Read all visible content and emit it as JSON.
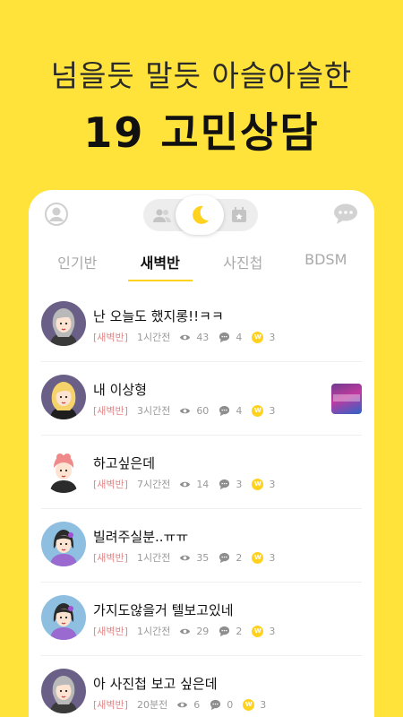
{
  "promo": {
    "headline": "넘을듯 말듯 아슬아슬한",
    "title": "19 고민상담"
  },
  "header": {
    "profile_icon": "person-icon",
    "toggle_left_icon": "people-icon",
    "toggle_mid_icon": "moon-icon",
    "toggle_right_icon": "calendar-star-icon",
    "chat_icon": "chat-bubble-icon"
  },
  "tabs": [
    {
      "label": "인기반",
      "active": false
    },
    {
      "label": "새벽반",
      "active": true
    },
    {
      "label": "사진첩",
      "active": false
    },
    {
      "label": "BDSM",
      "active": false
    }
  ],
  "posts": [
    {
      "title": "난 오늘도 했지롱!!ㅋㅋ",
      "tag": "[새벽반]",
      "time": "1시간전",
      "views": "43",
      "comments": "4",
      "coins": "3",
      "avatar": "gray-hair-woman"
    },
    {
      "title": "내 이상형",
      "tag": "[새벽반]",
      "time": "3시간전",
      "views": "60",
      "comments": "4",
      "coins": "3",
      "avatar": "blonde-woman",
      "has_thumb": true
    },
    {
      "title": "하고싶은데",
      "tag": "[새벽반]",
      "time": "7시간전",
      "views": "14",
      "comments": "3",
      "coins": "3",
      "avatar": "pink-hair-boy"
    },
    {
      "title": "빌려주실분..ㅠㅠ",
      "tag": "[새벽반]",
      "time": "1시간전",
      "views": "35",
      "comments": "2",
      "coins": "3",
      "avatar": "flower-woman"
    },
    {
      "title": "가지도않을거 텔보고있네",
      "tag": "[새벽반]",
      "time": "1시간전",
      "views": "29",
      "comments": "2",
      "coins": "3",
      "avatar": "flower-woman"
    },
    {
      "title": "아 사진첩 보고 싶은데",
      "tag": "[새벽반]",
      "time": "20분전",
      "views": "6",
      "comments": "0",
      "coins": "3",
      "avatar": "gray-hair-woman"
    }
  ],
  "colors": {
    "accent": "#FFE23A",
    "tag": "#e08888",
    "coin": "#FFD21F"
  }
}
